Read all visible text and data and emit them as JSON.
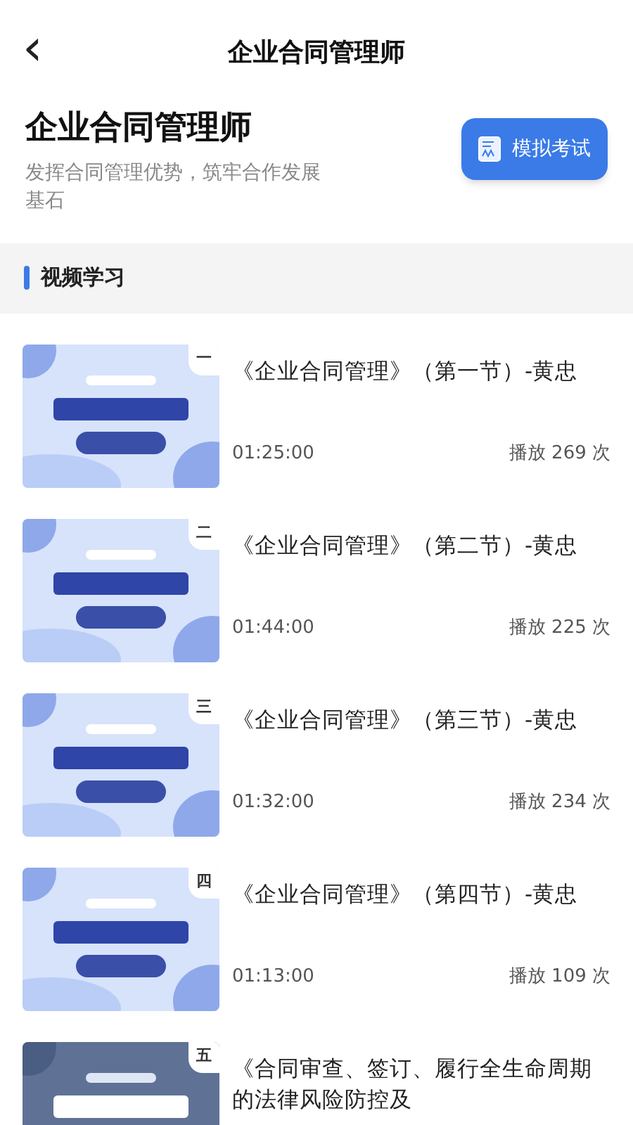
{
  "nav": {
    "back_icon": "‹",
    "title": "企业合同管理师"
  },
  "hero": {
    "title": "企业合同管理师",
    "subtitle": "发挥合同管理优势，筑牢合作发展基石",
    "button": "模拟考试"
  },
  "section": {
    "title": "视频学习"
  },
  "videos": [
    {
      "badge": "一",
      "kind": "light",
      "title": "《企业合同管理》（第一节）-黄忠",
      "duration": "01:25:00",
      "plays": "播放 269 次"
    },
    {
      "badge": "二",
      "kind": "light",
      "title": "《企业合同管理》（第二节）-黄忠",
      "duration": "01:44:00",
      "plays": "播放 225 次"
    },
    {
      "badge": "三",
      "kind": "light",
      "title": "《企业合同管理》（第三节）-黄忠",
      "duration": "01:32:00",
      "plays": "播放 234 次"
    },
    {
      "badge": "四",
      "kind": "light",
      "title": "《企业合同管理》（第四节）-黄忠",
      "duration": "01:13:00",
      "plays": "播放 109 次"
    },
    {
      "badge": "五",
      "kind": "dark",
      "title": "《合同审查、签订、履行全生命周期的法律风险防控及"
    }
  ]
}
